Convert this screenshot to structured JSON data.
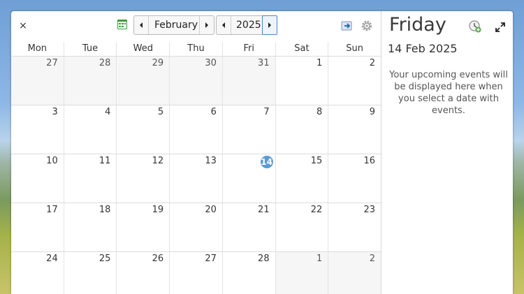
{
  "header": {
    "close_label": "×",
    "month": "February",
    "year": "2025",
    "icons": [
      "close-icon",
      "calendar-app-icon",
      "previous-month-icon",
      "next-month-icon",
      "previous-year-icon",
      "next-year-icon",
      "export-icon",
      "settings-icon",
      "add-event-icon",
      "expand-icon"
    ]
  },
  "calendar": {
    "weekdays": [
      "Mon",
      "Tue",
      "Wed",
      "Thu",
      "Fri",
      "Sat",
      "Sun"
    ],
    "weeks": [
      [
        "27",
        "28",
        "29",
        "30",
        "31",
        "1",
        "2"
      ],
      [
        "3",
        "4",
        "5",
        "6",
        "7",
        "8",
        "9"
      ],
      [
        "10",
        "11",
        "12",
        "13",
        "14",
        "15",
        "16"
      ],
      [
        "17",
        "18",
        "19",
        "20",
        "21",
        "22",
        "23"
      ],
      [
        "24",
        "25",
        "26",
        "27",
        "28",
        "1",
        "2"
      ]
    ],
    "today": "14"
  },
  "sidebar": {
    "weekday": "Friday",
    "date": "14 Feb 2025",
    "message": "Your upcoming events will be displayed here when you select a date with events."
  },
  "colors": {
    "today_accent": "#5b9bd5",
    "focus_border": "#4a86c8"
  }
}
